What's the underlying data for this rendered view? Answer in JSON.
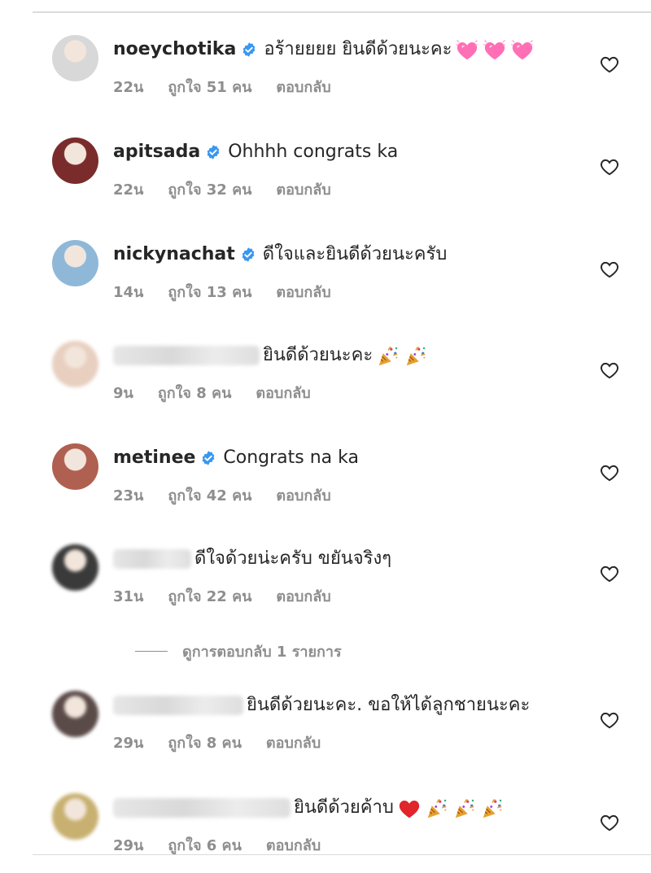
{
  "comments": [
    {
      "username": "noeychotika",
      "verified": true,
      "text": "อร้ายยยย ยินดีด้วยนะคะ",
      "emoji": [
        "pink-heart",
        "pink-heart",
        "pink-heart"
      ],
      "time": "22น",
      "likes": "ถูกใจ 51 คน",
      "reply": "ตอบกลับ",
      "avatar_color": "#d8d8d8"
    },
    {
      "username": "apitsada",
      "verified": true,
      "text": "Ohhhh congrats ka",
      "emoji": [],
      "time": "22น",
      "likes": "ถูกใจ 32 คน",
      "reply": "ตอบกลับ",
      "avatar_color": "#7a2c2c"
    },
    {
      "username": "nickynachat",
      "verified": true,
      "text": "ดีใจและยินดีด้วยนะครับ",
      "emoji": [],
      "time": "14น",
      "likes": "ถูกใจ 13 คน",
      "reply": "ตอบกลับ",
      "avatar_color": "#8fb8d8"
    },
    {
      "username": "",
      "verified": false,
      "text": "ยินดีด้วยนะคะ",
      "emoji": [
        "party-popper",
        "party-popper"
      ],
      "time": "9น",
      "likes": "ถูกใจ 8 คน",
      "reply": "ตอบกลับ",
      "avatar_color": "#e8cfc0"
    },
    {
      "username": "metinee",
      "verified": true,
      "text": "Congrats na ka",
      "emoji": [],
      "time": "23น",
      "likes": "ถูกใจ 42 คน",
      "reply": "ตอบกลับ",
      "avatar_color": "#b06050"
    },
    {
      "username": "",
      "verified": false,
      "text": "ดีใจด้วยน่ะครับ ขยันจริงๆ",
      "emoji": [],
      "time": "31น",
      "likes": "ถูกใจ 22 คน",
      "reply": "ตอบกลับ",
      "avatar_color": "#3a3a3a"
    },
    {
      "username": "",
      "verified": false,
      "text": "ยินดีด้วยนะคะ. ขอให้ได้ลูกชายนะคะ",
      "emoji": [],
      "time": "29น",
      "likes": "ถูกใจ 8 คน",
      "reply": "ตอบกลับ",
      "avatar_color": "#5a4a48"
    },
    {
      "username": "",
      "verified": false,
      "text": "ยินดีด้วยค้าบ",
      "emoji": [
        "red-heart",
        "party-popper",
        "party-popper",
        "party-popper"
      ],
      "time": "29น",
      "likes": "ถูกใจ 6 คน",
      "reply": "ตอบกลับ",
      "avatar_color": "#c8b070"
    }
  ],
  "view_replies": "ดูการตอบกลับ 1 รายการ",
  "colors": {
    "verified": "#3897f0",
    "secondary_text": "#8e8e8e",
    "primary_text": "#262626",
    "pink_heart": "#ff6fb5",
    "red_heart": "#e0252b"
  }
}
